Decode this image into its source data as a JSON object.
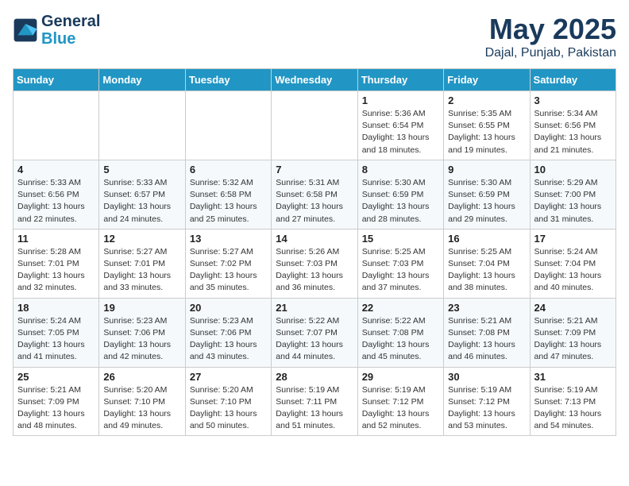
{
  "logo": {
    "line1": "General",
    "line2": "Blue"
  },
  "title": "May 2025",
  "subtitle": "Dajal, Punjab, Pakistan",
  "days_of_week": [
    "Sunday",
    "Monday",
    "Tuesday",
    "Wednesday",
    "Thursday",
    "Friday",
    "Saturday"
  ],
  "weeks": [
    [
      {
        "day": "",
        "info": ""
      },
      {
        "day": "",
        "info": ""
      },
      {
        "day": "",
        "info": ""
      },
      {
        "day": "",
        "info": ""
      },
      {
        "day": "1",
        "info": "Sunrise: 5:36 AM\nSunset: 6:54 PM\nDaylight: 13 hours\nand 18 minutes."
      },
      {
        "day": "2",
        "info": "Sunrise: 5:35 AM\nSunset: 6:55 PM\nDaylight: 13 hours\nand 19 minutes."
      },
      {
        "day": "3",
        "info": "Sunrise: 5:34 AM\nSunset: 6:56 PM\nDaylight: 13 hours\nand 21 minutes."
      }
    ],
    [
      {
        "day": "4",
        "info": "Sunrise: 5:33 AM\nSunset: 6:56 PM\nDaylight: 13 hours\nand 22 minutes."
      },
      {
        "day": "5",
        "info": "Sunrise: 5:33 AM\nSunset: 6:57 PM\nDaylight: 13 hours\nand 24 minutes."
      },
      {
        "day": "6",
        "info": "Sunrise: 5:32 AM\nSunset: 6:58 PM\nDaylight: 13 hours\nand 25 minutes."
      },
      {
        "day": "7",
        "info": "Sunrise: 5:31 AM\nSunset: 6:58 PM\nDaylight: 13 hours\nand 27 minutes."
      },
      {
        "day": "8",
        "info": "Sunrise: 5:30 AM\nSunset: 6:59 PM\nDaylight: 13 hours\nand 28 minutes."
      },
      {
        "day": "9",
        "info": "Sunrise: 5:30 AM\nSunset: 6:59 PM\nDaylight: 13 hours\nand 29 minutes."
      },
      {
        "day": "10",
        "info": "Sunrise: 5:29 AM\nSunset: 7:00 PM\nDaylight: 13 hours\nand 31 minutes."
      }
    ],
    [
      {
        "day": "11",
        "info": "Sunrise: 5:28 AM\nSunset: 7:01 PM\nDaylight: 13 hours\nand 32 minutes."
      },
      {
        "day": "12",
        "info": "Sunrise: 5:27 AM\nSunset: 7:01 PM\nDaylight: 13 hours\nand 33 minutes."
      },
      {
        "day": "13",
        "info": "Sunrise: 5:27 AM\nSunset: 7:02 PM\nDaylight: 13 hours\nand 35 minutes."
      },
      {
        "day": "14",
        "info": "Sunrise: 5:26 AM\nSunset: 7:03 PM\nDaylight: 13 hours\nand 36 minutes."
      },
      {
        "day": "15",
        "info": "Sunrise: 5:25 AM\nSunset: 7:03 PM\nDaylight: 13 hours\nand 37 minutes."
      },
      {
        "day": "16",
        "info": "Sunrise: 5:25 AM\nSunset: 7:04 PM\nDaylight: 13 hours\nand 38 minutes."
      },
      {
        "day": "17",
        "info": "Sunrise: 5:24 AM\nSunset: 7:04 PM\nDaylight: 13 hours\nand 40 minutes."
      }
    ],
    [
      {
        "day": "18",
        "info": "Sunrise: 5:24 AM\nSunset: 7:05 PM\nDaylight: 13 hours\nand 41 minutes."
      },
      {
        "day": "19",
        "info": "Sunrise: 5:23 AM\nSunset: 7:06 PM\nDaylight: 13 hours\nand 42 minutes."
      },
      {
        "day": "20",
        "info": "Sunrise: 5:23 AM\nSunset: 7:06 PM\nDaylight: 13 hours\nand 43 minutes."
      },
      {
        "day": "21",
        "info": "Sunrise: 5:22 AM\nSunset: 7:07 PM\nDaylight: 13 hours\nand 44 minutes."
      },
      {
        "day": "22",
        "info": "Sunrise: 5:22 AM\nSunset: 7:08 PM\nDaylight: 13 hours\nand 45 minutes."
      },
      {
        "day": "23",
        "info": "Sunrise: 5:21 AM\nSunset: 7:08 PM\nDaylight: 13 hours\nand 46 minutes."
      },
      {
        "day": "24",
        "info": "Sunrise: 5:21 AM\nSunset: 7:09 PM\nDaylight: 13 hours\nand 47 minutes."
      }
    ],
    [
      {
        "day": "25",
        "info": "Sunrise: 5:21 AM\nSunset: 7:09 PM\nDaylight: 13 hours\nand 48 minutes."
      },
      {
        "day": "26",
        "info": "Sunrise: 5:20 AM\nSunset: 7:10 PM\nDaylight: 13 hours\nand 49 minutes."
      },
      {
        "day": "27",
        "info": "Sunrise: 5:20 AM\nSunset: 7:10 PM\nDaylight: 13 hours\nand 50 minutes."
      },
      {
        "day": "28",
        "info": "Sunrise: 5:19 AM\nSunset: 7:11 PM\nDaylight: 13 hours\nand 51 minutes."
      },
      {
        "day": "29",
        "info": "Sunrise: 5:19 AM\nSunset: 7:12 PM\nDaylight: 13 hours\nand 52 minutes."
      },
      {
        "day": "30",
        "info": "Sunrise: 5:19 AM\nSunset: 7:12 PM\nDaylight: 13 hours\nand 53 minutes."
      },
      {
        "day": "31",
        "info": "Sunrise: 5:19 AM\nSunset: 7:13 PM\nDaylight: 13 hours\nand 54 minutes."
      }
    ]
  ]
}
